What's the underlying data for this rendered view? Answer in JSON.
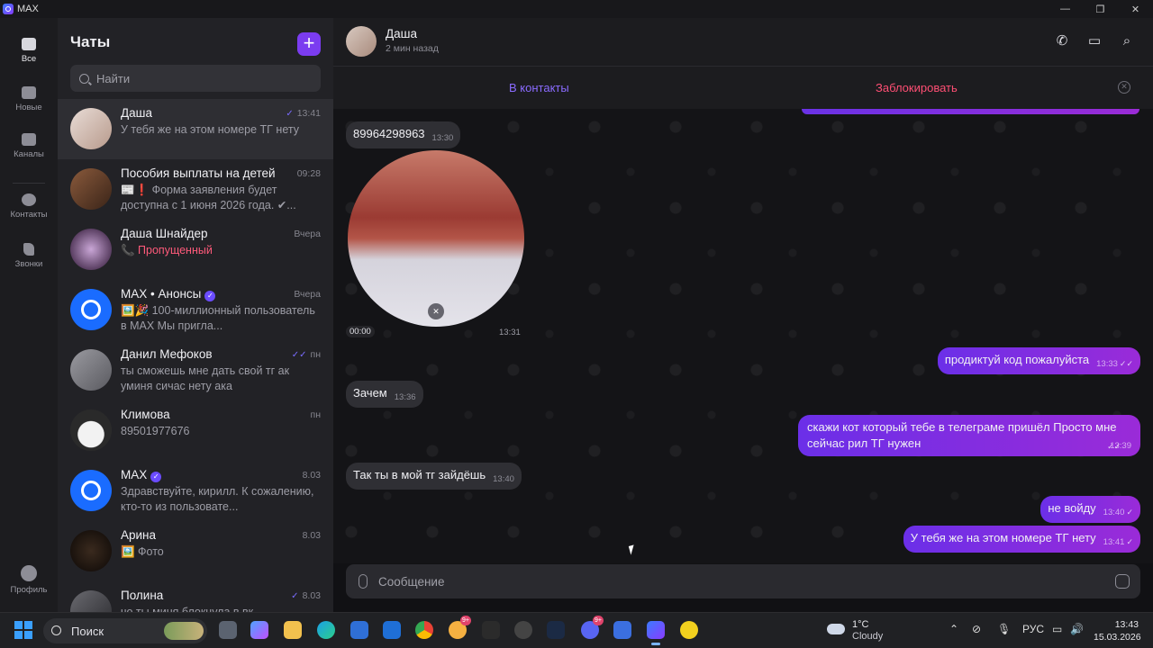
{
  "window": {
    "app_name": "MAX",
    "minimize": "—",
    "maximize": "❐",
    "close": "✕"
  },
  "rail": {
    "items": [
      {
        "label": "Все",
        "icon": "chats-icon"
      },
      {
        "label": "Новые",
        "icon": "folder-icon"
      },
      {
        "label": "Каналы",
        "icon": "folder-icon"
      },
      {
        "label": "Контакты",
        "icon": "contacts-icon"
      },
      {
        "label": "Звонки",
        "icon": "phone-icon"
      },
      {
        "label": "Профиль",
        "icon": "profile-icon"
      }
    ]
  },
  "list": {
    "title": "Чаты",
    "new_button": "+",
    "search_placeholder": "Найти",
    "chats": [
      {
        "name": "Даша",
        "time": "13:41",
        "preview": "У тебя же на этом номере ТГ нету",
        "tick": "✓"
      },
      {
        "name": "Пособия выплаты на детей",
        "time": "09:28",
        "preview": "📰❗ Форма заявления будет доступна с 1 июня 2026 года. ✔..."
      },
      {
        "name": "Даша Шнайдер",
        "time": "Вчера",
        "preview": "📞 Пропущенный"
      },
      {
        "name": "MAX • Анонсы",
        "time": "Вчера",
        "preview": "🖼️🎉 100-миллионный пользователь в MAX  Мы пригла...",
        "verified": "✓"
      },
      {
        "name": "Данил Мефоков",
        "time": "пн",
        "preview": "ты сможешь мне дать свой тг ак уминя сичас нету ака",
        "tick": "✓✓"
      },
      {
        "name": "Климова",
        "time": "пн",
        "preview": "89501977676"
      },
      {
        "name": "MAX",
        "time": "8.03",
        "preview": "Здравствуйте, кирилл.  К сожалению, кто-то из пользовате...",
        "verified": "✓"
      },
      {
        "name": "Арина",
        "time": "8.03",
        "preview": "🖼️ Фото"
      },
      {
        "name": "Полина",
        "time": "8.03",
        "preview": "чо ты миня блокнула в вк",
        "tick": "✓"
      }
    ]
  },
  "chat": {
    "name": "Даша",
    "status": "2 мин назад",
    "add_contact": "В контакты",
    "block": "Заблокировать",
    "close_bar": "✕",
    "video_duration": "00:00",
    "video_time": "13:31",
    "messages": [
      {
        "dir": "in",
        "text": "89964298963",
        "time": "13:30"
      },
      {
        "dir": "out",
        "text": "продиктуй код пожалуйста",
        "time": "13:33",
        "check": "✓✓"
      },
      {
        "dir": "in",
        "text": "Зачем",
        "time": "13:36"
      },
      {
        "dir": "out",
        "text": "скажи кот который тебе в телеграме пришёл Просто мне сейчас рил ТГ нужен",
        "time": "13:39",
        "check": "✓✓"
      },
      {
        "dir": "in",
        "text": "Так ты в мой тг зайдёшь",
        "time": "13:40"
      },
      {
        "dir": "out",
        "text": "не войду",
        "time": "13:40",
        "check": "✓"
      },
      {
        "dir": "out",
        "text": "У тебя же на этом номере ТГ нету",
        "time": "13:41",
        "check": "✓"
      }
    ],
    "composer_placeholder": "Сообщение"
  },
  "taskbar": {
    "search_label": "Поиск",
    "badge_a": "9+",
    "badge_b": "9+",
    "weather_temp": "1°C",
    "weather_cond": "Cloudy",
    "lang": "РУС",
    "time": "13:43",
    "date": "15.03.2026"
  },
  "colors": {
    "accent": "#7b3cf0",
    "danger": "#ff4f74",
    "link": "#8a6bff"
  }
}
